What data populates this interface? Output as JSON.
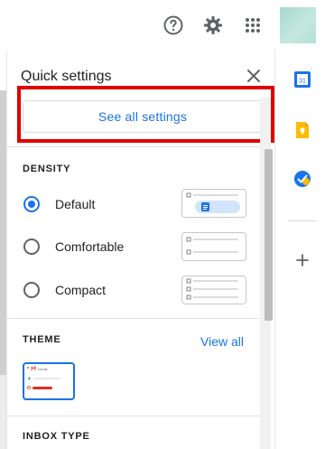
{
  "quick_settings": {
    "title": "Quick settings",
    "see_all_label": "See all settings"
  },
  "density": {
    "label": "DENSITY",
    "options": [
      {
        "label": "Default",
        "selected": true
      },
      {
        "label": "Comfortable",
        "selected": false
      },
      {
        "label": "Compact",
        "selected": false
      }
    ]
  },
  "theme": {
    "label": "THEME",
    "view_all_label": "View all",
    "thumbnail_text": "Gmail"
  },
  "inbox_type": {
    "label": "INBOX TYPE"
  },
  "side_panel": {
    "calendar_day": "31"
  },
  "colors": {
    "accent": "#1a73e8",
    "highlight": "#e00000"
  }
}
